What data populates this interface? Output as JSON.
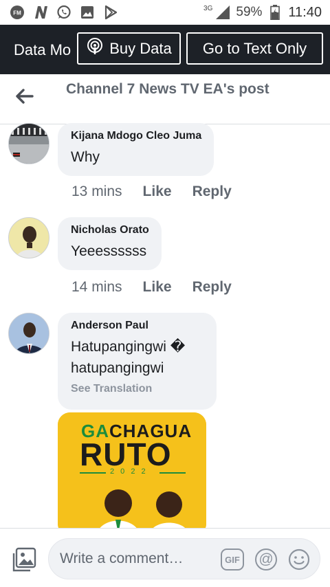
{
  "status_bar": {
    "network_type": "3G",
    "battery": "59%",
    "time": "11:40",
    "icons": [
      "fm-radio-icon",
      "n-app-icon",
      "whatsapp-icon",
      "image-icon",
      "play-store-icon"
    ]
  },
  "data_bar": {
    "mode_label": "Data Mo",
    "buy_label": "Buy Data",
    "text_only_label": "Go to Text Only"
  },
  "header": {
    "title": "Channel 7 News TV EA's post"
  },
  "comments": [
    {
      "author": "Kijana Mdogo Cleo Juma",
      "text": "Why",
      "time": "13 mins",
      "like": "Like",
      "reply": "Reply"
    },
    {
      "author": "Nicholas Orato",
      "text": "Yeeessssss",
      "time": "14 mins",
      "like": "Like",
      "reply": "Reply"
    },
    {
      "author": "Anderson Paul",
      "text_line1": "Hatupangingwi �",
      "text_line2": "hatupangingwi",
      "see_translation": "See Translation"
    }
  ],
  "sticker": {
    "line1_a": "GA",
    "line1_b": "CHAGUA",
    "line2": "RUTO",
    "year": "2 0 2 2"
  },
  "composer": {
    "placeholder": "Write a comment…",
    "gif_label": "GIF",
    "at_label": "@"
  },
  "colors": {
    "data_bar_bg": "#1d2127",
    "bubble_bg": "#f0f2f5",
    "sticker_yellow": "#f5c11b",
    "sticker_green": "#1c8c3c"
  }
}
